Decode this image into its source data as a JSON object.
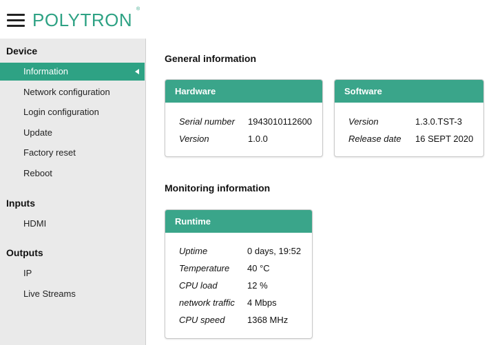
{
  "brand": {
    "logo_text": "POLYTRON",
    "registered_mark": "®",
    "accent_color": "#2ea284"
  },
  "sidebar": {
    "sections": [
      {
        "title": "Device",
        "items": [
          "Information",
          "Network configuration",
          "Login configuration",
          "Update",
          "Factory reset",
          "Reboot"
        ]
      },
      {
        "title": "Inputs",
        "items": [
          "HDMI"
        ]
      },
      {
        "title": "Outputs",
        "items": [
          "IP",
          "Live Streams"
        ]
      }
    ],
    "active_item": "Information"
  },
  "main": {
    "general_title": "General information",
    "hardware": {
      "title": "Hardware",
      "rows": [
        {
          "label": "Serial number",
          "value": "1943010112600"
        },
        {
          "label": "Version",
          "value": "1.0.0"
        }
      ]
    },
    "software": {
      "title": "Software",
      "rows": [
        {
          "label": "Version",
          "value": "1.3.0.TST-3"
        },
        {
          "label": "Release date",
          "value": "16 SEPT 2020"
        }
      ]
    },
    "monitoring_title": "Monitoring information",
    "runtime": {
      "title": "Runtime",
      "rows": [
        {
          "label": "Uptime",
          "value": "0 days, 19:52"
        },
        {
          "label": "Temperature",
          "value": "40 °C"
        },
        {
          "label": "CPU load",
          "value": "12 %"
        },
        {
          "label": "network traffic",
          "value": "4 Mbps"
        },
        {
          "label": "CPU speed",
          "value": "1368 MHz"
        }
      ]
    }
  }
}
